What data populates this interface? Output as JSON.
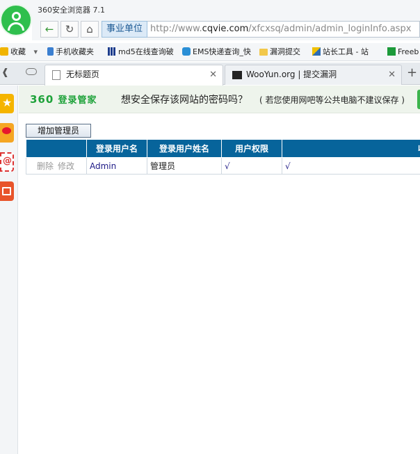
{
  "window": {
    "title": "360安全浏览器 7.1"
  },
  "nav": {
    "zone_label": "事业单位",
    "url_scheme": "http://www.",
    "url_host": "cqvie.com",
    "url_path": "/xfcxsq/admin/admin_loginInfo.aspx"
  },
  "bookmarks": {
    "items": [
      {
        "label": "收藏"
      },
      {
        "label": "手机收藏夹"
      },
      {
        "label": "md5在线查询破"
      },
      {
        "label": "EMS快递查询_快"
      },
      {
        "label": "漏洞提交"
      },
      {
        "label": "站长工具 - 站"
      },
      {
        "label": "Freeb"
      }
    ]
  },
  "tabs": [
    {
      "label": "无标题页"
    },
    {
      "label": "WooYun.org | 提交漏洞"
    }
  ],
  "password_bar": {
    "logo_brand": "360",
    "logo_text": "登录管家",
    "question": "想安全保存该网站的密码吗？",
    "hint": "( 若您使用网吧等公共电脑不建议保存 )"
  },
  "page": {
    "add_button": "增加管理员",
    "table": {
      "headers": [
        "",
        "登录用户名",
        "登录用户姓名",
        "用户权限",
        "收"
      ],
      "rows": [
        {
          "delete": "删除",
          "edit": "修改",
          "username": "Admin",
          "realname": "管理员",
          "permission": "√",
          "collect": "√"
        }
      ]
    }
  },
  "colors": {
    "header_bg": "#07649b",
    "accent_green": "#1ea23a"
  }
}
